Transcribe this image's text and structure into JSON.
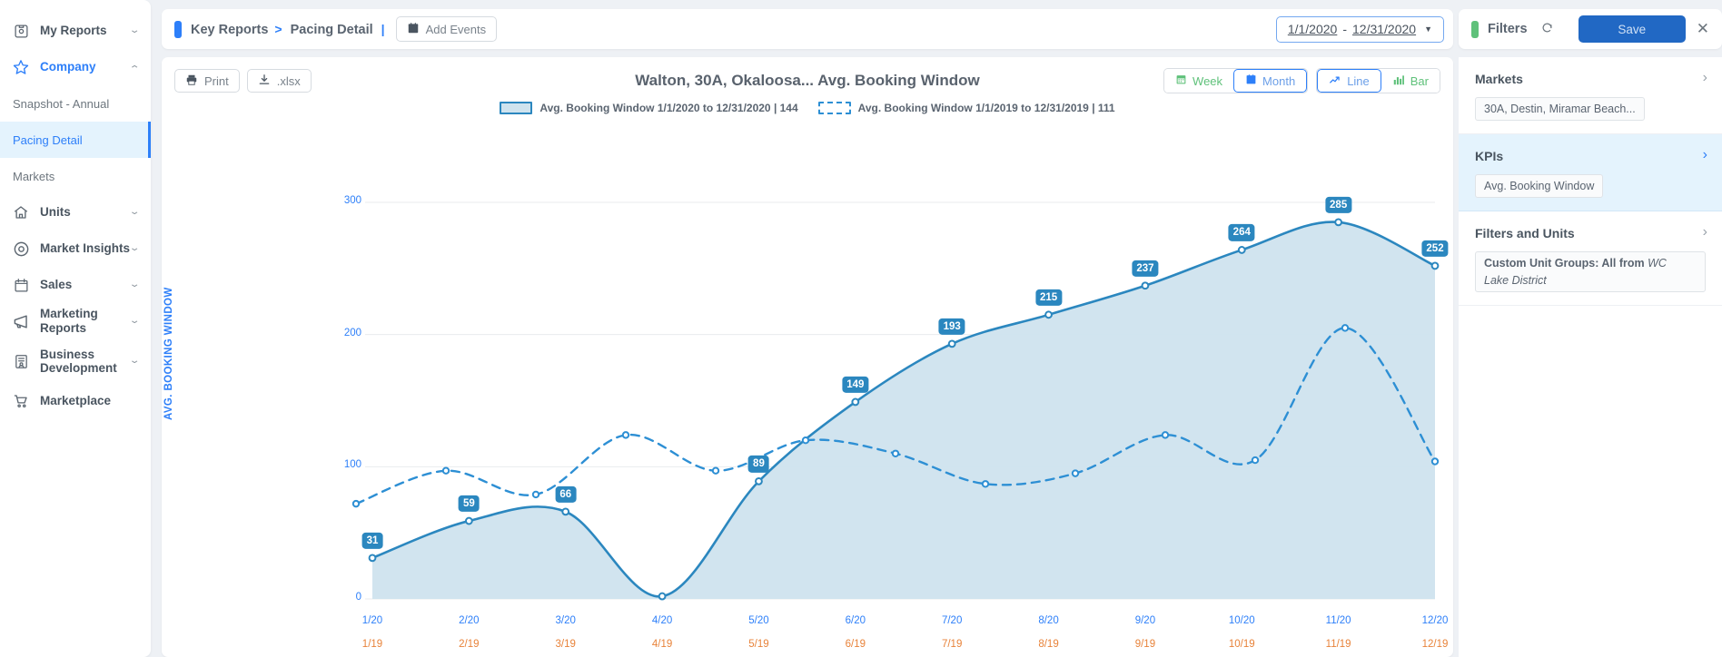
{
  "sidebar": {
    "groups": [
      {
        "label": "My Reports",
        "icon": "report-icon",
        "expanded": false,
        "active": false
      },
      {
        "label": "Company",
        "icon": "star-icon",
        "expanded": true,
        "active": true
      },
      {
        "label": "Units",
        "icon": "home-icon",
        "expanded": false,
        "active": false
      },
      {
        "label": "Market Insights",
        "icon": "eye-icon",
        "expanded": false,
        "active": false
      },
      {
        "label": "Sales",
        "icon": "calendar-icon",
        "expanded": false,
        "active": false
      },
      {
        "label": "Marketing Reports",
        "icon": "megaphone-icon",
        "expanded": false,
        "active": false
      },
      {
        "label": "Business Development",
        "icon": "contact-list-icon",
        "expanded": false,
        "active": false
      },
      {
        "label": "Marketplace",
        "icon": "cart-icon",
        "expanded": false,
        "active": false
      }
    ],
    "company_items": [
      {
        "label": "Snapshot - Annual",
        "selected": false
      },
      {
        "label": "Pacing Detail",
        "selected": true
      },
      {
        "label": "Markets",
        "selected": false
      }
    ]
  },
  "topbar": {
    "breadcrumb_root": "Key Reports",
    "breadcrumb_sep": ">",
    "breadcrumb_current": "Pacing Detail",
    "divider": "|",
    "add_events_label": "Add Events",
    "add_events_icon": "calendar-icon",
    "date_start": "1/1/2020",
    "date_dash": "-",
    "date_end": "12/31/2020",
    "date_caret": "▼"
  },
  "chart_panel": {
    "print_label": "Print",
    "print_icon": "printer-icon",
    "xlsx_label": ".xlsx",
    "xlsx_icon": "download-icon",
    "granularity": [
      {
        "label": "Week",
        "icon": "calendar-icon",
        "active": false,
        "color": "#5fc17a"
      },
      {
        "label": "Month",
        "icon": "calendar-icon",
        "active": true,
        "color": "#6b9fe8"
      }
    ],
    "charttype": [
      {
        "label": "Line",
        "icon": "line-chart-icon",
        "active": true,
        "color": "#6b9fe8"
      },
      {
        "label": "Bar",
        "icon": "bar-chart-icon",
        "active": false,
        "color": "#5fc17a"
      }
    ]
  },
  "filters": {
    "title": "Filters",
    "refresh_icon": "refresh-icon",
    "save_label": "Save",
    "close_icon": "close-icon",
    "sections": [
      {
        "title": "Markets",
        "arrow": "›",
        "highlight": false,
        "chip": "30A, Destin, Miramar Beach..."
      },
      {
        "title": "KPIs",
        "arrow": "›",
        "highlight": true,
        "chip": "Avg. Booking Window"
      },
      {
        "title": "Filters and Units",
        "arrow": "›",
        "highlight": false,
        "chip_bold": "Custom Unit Groups: All from ",
        "chip_italic": "WC",
        "chip_sub": "Lake District"
      }
    ]
  },
  "chart_data": {
    "type": "area",
    "title": "Walton, 30A, Okaloosa... Avg. Booking Window",
    "xlabel": "",
    "ylabel": "AVG. BOOKING WINDOW",
    "ylim": [
      0,
      300
    ],
    "yticks": [
      0,
      100,
      200,
      300
    ],
    "grid": true,
    "legend_position": "top-center",
    "categories_current": [
      "1/20",
      "2/20",
      "3/20",
      "4/20",
      "5/20",
      "6/20",
      "7/20",
      "8/20",
      "9/20",
      "10/20",
      "11/20",
      "12/20"
    ],
    "categories_prior": [
      "1/19",
      "2/19",
      "3/19",
      "4/19",
      "5/19",
      "6/19",
      "7/19",
      "8/19",
      "9/19",
      "10/19",
      "11/19",
      "12/19"
    ],
    "series": [
      {
        "name": "Avg. Booking Window 1/1/2020 to 12/31/2020 | 144",
        "legend_label": "Avg. Booking Window 1/1/2020 to 12/31/2020 | 144",
        "average": 144,
        "style": "solid",
        "color": "#2b87bf",
        "fill": "#cfe3ee",
        "labeled": true,
        "values": [
          31,
          59,
          66,
          2,
          89,
          149,
          193,
          215,
          237,
          264,
          285,
          252
        ],
        "point_labels": [
          "31",
          "59",
          "66",
          "",
          "89",
          "149",
          "193",
          "215",
          "237",
          "264",
          "285",
          "252"
        ]
      },
      {
        "name": "Avg. Booking Window 1/1/2019 to 12/31/2019 | 111",
        "legend_label": "Avg. Booking Window 1/1/2019 to 12/31/2019 | 111",
        "average": 111,
        "style": "dashed",
        "color": "#2d8fd4",
        "fill": "none",
        "labeled": false,
        "values": [
          72,
          97,
          79,
          124,
          97,
          120,
          110,
          87,
          95,
          124,
          105,
          205,
          104
        ]
      }
    ]
  }
}
